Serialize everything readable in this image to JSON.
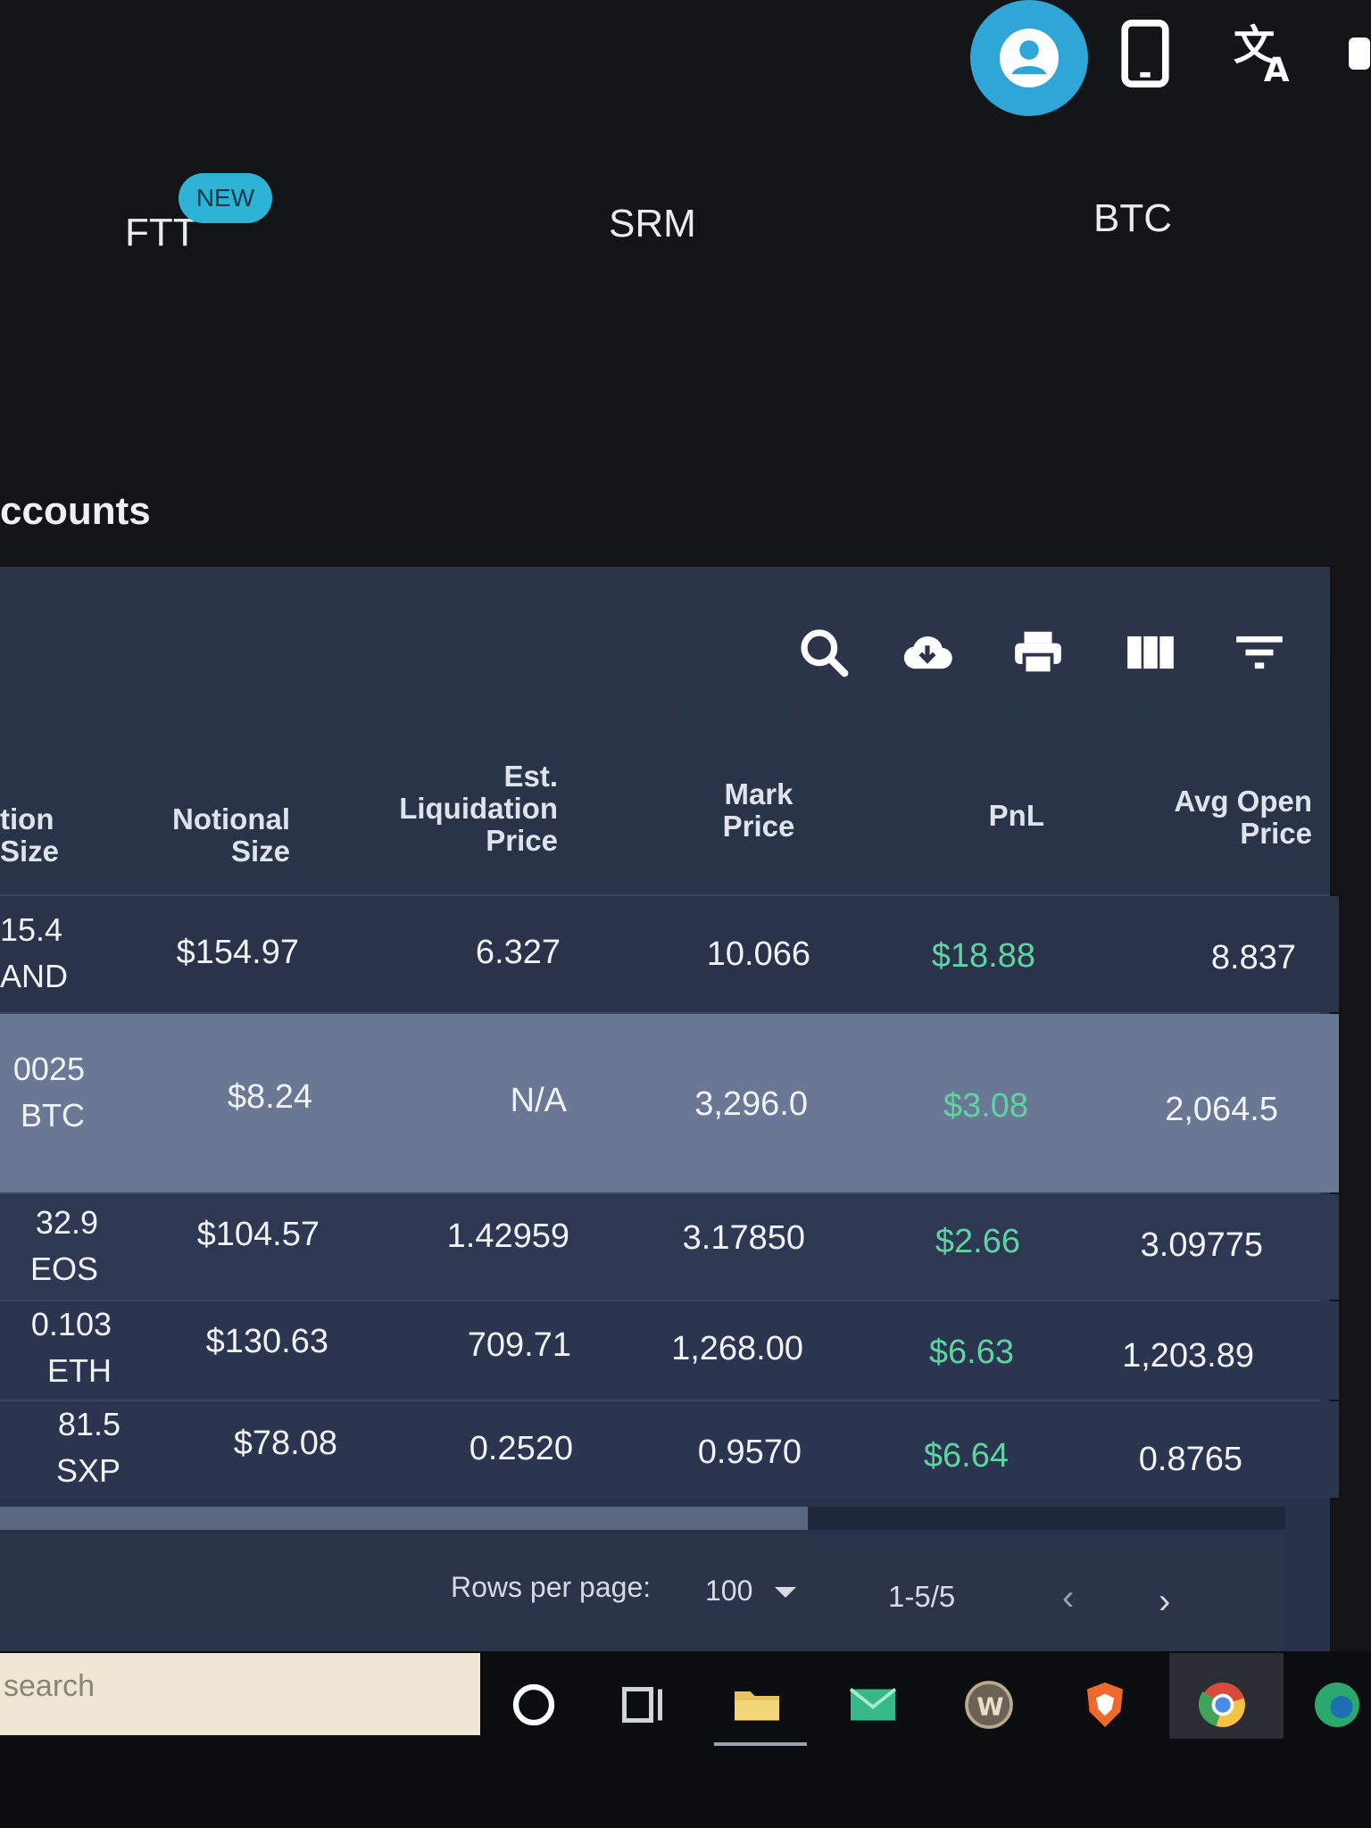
{
  "header": {
    "tabs": [
      {
        "label": "FTT",
        "badge": "NEW"
      },
      {
        "label": "SRM"
      },
      {
        "label": "BTC"
      }
    ],
    "icons": [
      "user-icon",
      "phone-icon",
      "translate-icon"
    ]
  },
  "section": {
    "title": "ccounts"
  },
  "toolbar": {
    "icons": [
      "search-icon",
      "download-icon",
      "print-icon",
      "columns-icon",
      "filter-icon"
    ]
  },
  "table": {
    "columns": [
      "tion Size",
      "Notional Size",
      "Est. Liquidation Price",
      "Mark Price",
      "PnL",
      "Avg Open Price"
    ],
    "rows": [
      {
        "size": "15.4",
        "unit": "AND",
        "notional": "$154.97",
        "liq": "6.327",
        "mark": "10.066",
        "pnl": "$18.88",
        "avg": "8.837"
      },
      {
        "size": "0025",
        "unit": "BTC",
        "notional": "$8.24",
        "liq": "N/A",
        "mark": "3,296.0",
        "pnl": "$3.08",
        "avg": "2,064.5"
      },
      {
        "size": "32.9",
        "unit": "EOS",
        "notional": "$104.57",
        "liq": "1.42959",
        "mark": "3.17850",
        "pnl": "$2.66",
        "avg": "3.09775"
      },
      {
        "size": "0.103",
        "unit": "ETH",
        "notional": "$130.63",
        "liq": "709.71",
        "mark": "1,268.00",
        "pnl": "$6.63",
        "avg": "1,203.89"
      },
      {
        "size": "81.5",
        "unit": "SXP",
        "notional": "$78.08",
        "liq": "0.2520",
        "mark": "0.9570",
        "pnl": "$6.64",
        "avg": "0.8765"
      }
    ]
  },
  "pagination": {
    "rows_per_page_label": "Rows per page:",
    "rows_per_page_value": "100",
    "range": "1-5/5"
  },
  "taskbar": {
    "search_placeholder": "search",
    "apps": [
      "cortana-icon",
      "task-view-icon",
      "file-explorer-icon",
      "mail-icon",
      "wow-icon",
      "brave-icon",
      "chrome-icon",
      "edge-icon"
    ]
  },
  "colors": {
    "accent": "#2fa5d8",
    "pnl_positive": "#5fd4a2",
    "table_bg": "#2b3449",
    "selected_row": "#6b7895"
  }
}
